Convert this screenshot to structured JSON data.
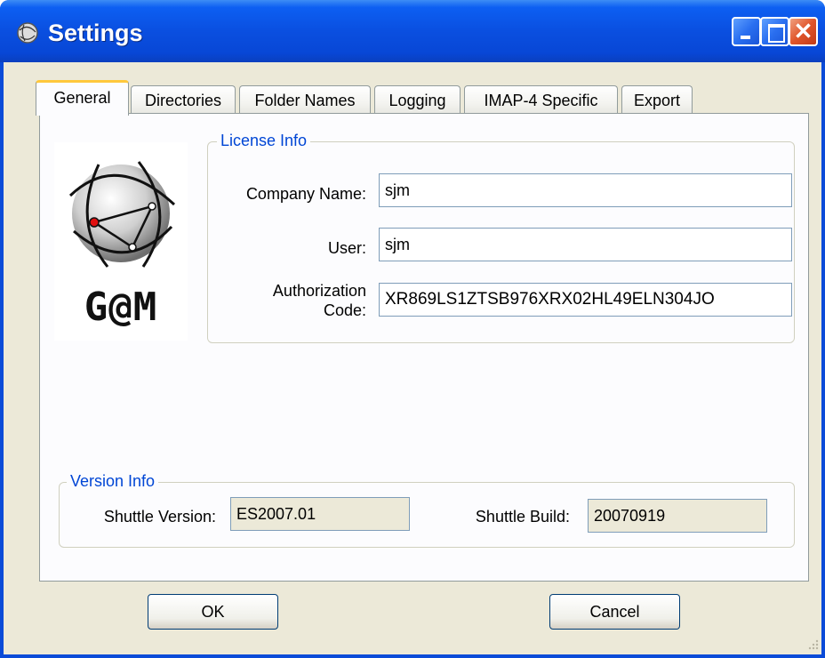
{
  "window": {
    "title": "Settings",
    "icon": "gem-app-icon"
  },
  "tabs": [
    {
      "label": "General",
      "active": true
    },
    {
      "label": "Directories"
    },
    {
      "label": "Folder Names"
    },
    {
      "label": "Logging"
    },
    {
      "label": "IMAP-4 Specific"
    },
    {
      "label": "Export"
    }
  ],
  "logo": {
    "text": "G@M"
  },
  "license": {
    "legend": "License Info",
    "company_label": "Company Name:",
    "company_value": "sjm",
    "user_label": "User:",
    "user_value": "sjm",
    "auth_label_line1": "Authorization",
    "auth_label_line2": "Code:",
    "auth_value": "XR869LS1ZTSB976XRX02HL49ELN304JO"
  },
  "version": {
    "legend": "Version Info",
    "shuttle_version_label": "Shuttle Version:",
    "shuttle_version_value": "ES2007.01",
    "shuttle_build_label": "Shuttle Build:",
    "shuttle_build_value": "20070919"
  },
  "buttons": {
    "ok": "OK",
    "cancel": "Cancel"
  },
  "colors": {
    "titlebar": "#0a4fe0",
    "legend": "#0046d5",
    "active_tab_accent": "#ffc83c",
    "close_button": "#e0552a"
  }
}
